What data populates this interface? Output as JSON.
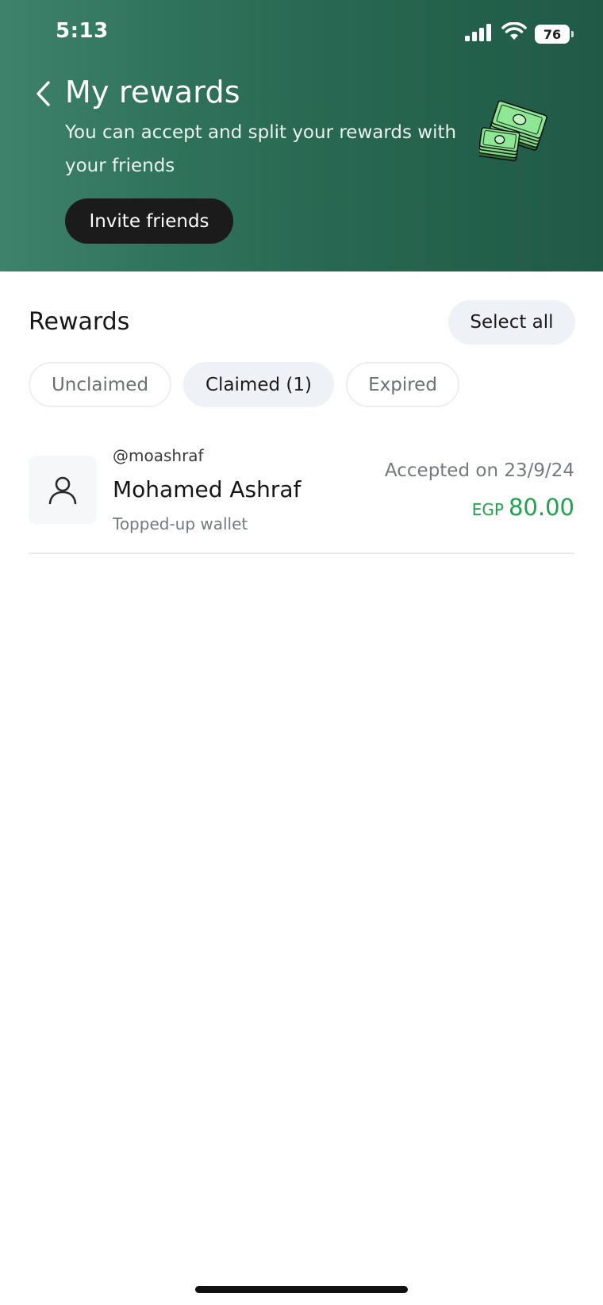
{
  "status_bar": {
    "time": "5:13",
    "battery": "76",
    "icons": [
      "cellular-signal-icon",
      "wifi-icon",
      "battery-icon"
    ]
  },
  "header": {
    "title": "My rewards",
    "subtitle": "You can accept and split your rewards with your friends",
    "invite_label": "Invite friends",
    "illustration": "money-stack-icon",
    "back_icon": "chevron-left-icon",
    "gradient_colors": [
      "#3f826c",
      "#1f5a46"
    ]
  },
  "rewards": {
    "section_title": "Rewards",
    "select_all_label": "Select all",
    "filters": [
      {
        "label": "Unclaimed",
        "active": false
      },
      {
        "label": "Claimed (1)",
        "active": true
      },
      {
        "label": "Expired",
        "active": false
      }
    ],
    "items": [
      {
        "username": "@moashraf",
        "name": "Mohamed Ashraf",
        "description": "Topped-up wallet",
        "status": "Accepted on 23/9/24",
        "currency": "EGP",
        "amount": "80.00",
        "avatar_icon": "user-icon"
      }
    ],
    "accent_color": "#1ea34d"
  }
}
